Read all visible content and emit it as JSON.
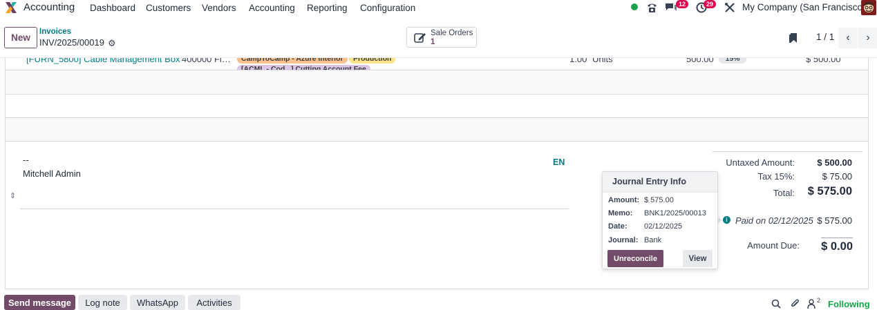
{
  "nav": {
    "app_title": "Accounting",
    "menu": [
      "Dashboard",
      "Customers",
      "Vendors",
      "Accounting",
      "Reporting",
      "Configuration"
    ],
    "messages_badge": "12",
    "activities_badge": "29",
    "company": "My Company (San Francisco)"
  },
  "control_panel": {
    "new_label": "New",
    "breadcrumb_parent": "Invoices",
    "breadcrumb_current": "INV/2025/00019",
    "smart_button": {
      "label": "Sale Orders",
      "count": "1"
    },
    "pager": "1 / 1"
  },
  "invoice_line": {
    "product": "[FURN_5800] Cable Management Box",
    "label": "400000 Fi…",
    "tags": [
      "CampToCamp - Azure Interior",
      "Production",
      "[ACML - Cod...] Cutting Account Fee"
    ],
    "quantity": "1.00",
    "uom": "Units",
    "price": "500.00",
    "tax": "15%",
    "subtotal": "$ 500.00"
  },
  "footer": {
    "signature_dash": "--",
    "signature_name": "Mitchell Admin",
    "lang": "EN"
  },
  "totals": {
    "untaxed_label": "Untaxed Amount:",
    "untaxed_value": "$ 500.00",
    "tax_label": "Tax 15%:",
    "tax_value": "$ 75.00",
    "total_label": "Total:",
    "total_value": "$ 575.00",
    "paid_label": "Paid on 02/12/2025",
    "paid_value": "$ 575.00",
    "due_label": "Amount Due:",
    "due_value": "$ 0.00"
  },
  "popover": {
    "title": "Journal Entry Info",
    "amount_key": "Amount:",
    "amount_val": "$ 575.00",
    "memo_key": "Memo:",
    "memo_val": "BNK1/2025/00013",
    "date_key": "Date:",
    "date_val": "02/12/2025",
    "journal_key": "Journal:",
    "journal_val": "Bank",
    "unreconcile_label": "Unreconcile",
    "view_label": "View"
  },
  "chatter": {
    "send_message": "Send message",
    "log_note": "Log note",
    "whatsapp": "WhatsApp",
    "activities": "Activities",
    "followers_count": "2",
    "following": "Following"
  },
  "colors": {
    "brand": "#714b67",
    "teal": "#017e84",
    "badge": "#e0004d",
    "online": "#16a34a"
  }
}
